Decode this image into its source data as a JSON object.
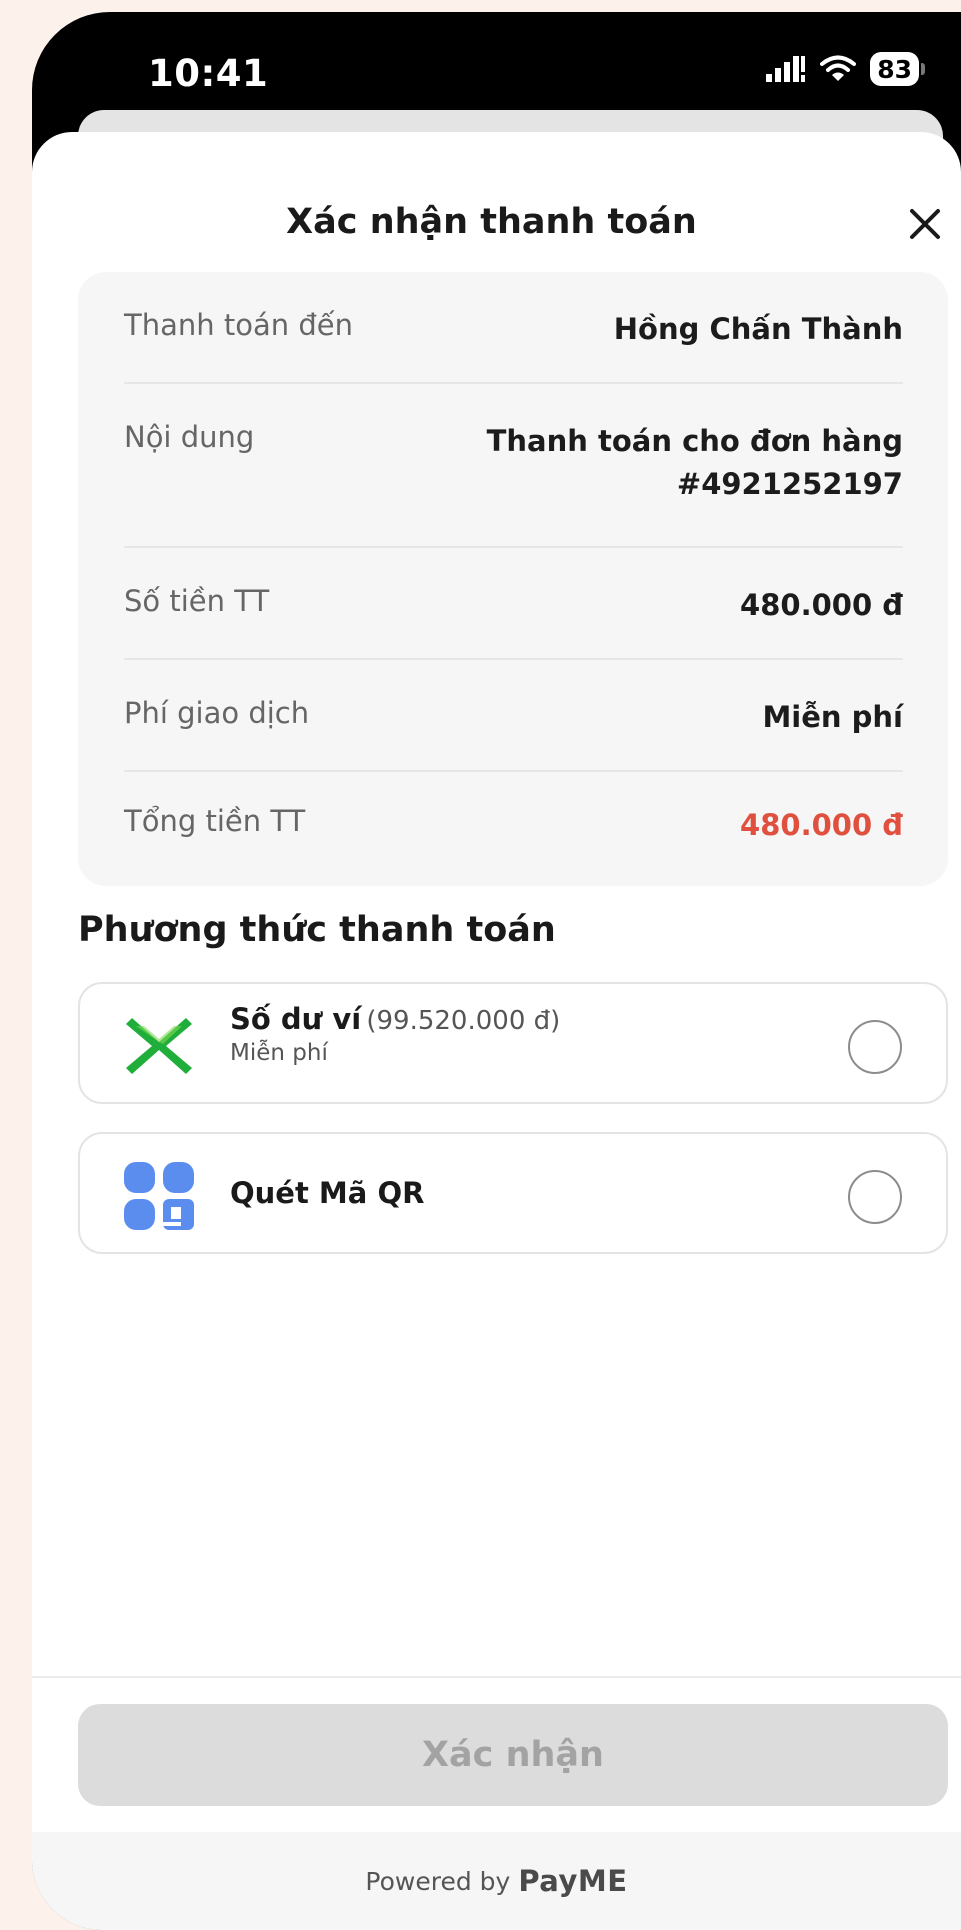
{
  "status_bar": {
    "time": "10:41",
    "battery": "83"
  },
  "sheet": {
    "title": "Xác nhận thanh toán"
  },
  "summary": {
    "rows": [
      {
        "label": "Thanh toán đến",
        "value": "Hồng Chấn Thành"
      },
      {
        "label": "Nội dung",
        "value_line1": "Thanh toán cho đơn hàng",
        "value_line2": "#4921252197"
      },
      {
        "label": "Số tiền TT",
        "value": "480.000 đ"
      },
      {
        "label": "Phí giao dịch",
        "value": "Miễn phí"
      },
      {
        "label": "Tổng tiền TT",
        "value": "480.000 đ"
      }
    ]
  },
  "payment_methods": {
    "title": "Phương thức thanh toán",
    "items": [
      {
        "name": "Số dư ví",
        "balance": "(99.520.000 đ)",
        "sub": "Miễn phí",
        "icon": "wallet-x-icon"
      },
      {
        "name": "Quét Mã QR",
        "icon": "qr-scan-icon"
      }
    ]
  },
  "footer": {
    "confirm_label": "Xác nhận",
    "powered_by": "Powered by",
    "brand": "PayME"
  },
  "colors": {
    "total_red": "#e0503f",
    "wallet_green": "#1fae3a",
    "qr_blue": "#5b8def"
  }
}
